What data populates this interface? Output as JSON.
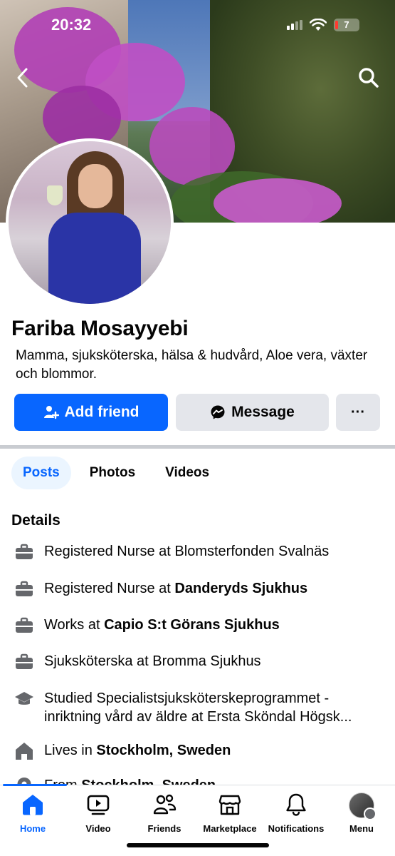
{
  "status_bar": {
    "time": "20:32",
    "battery_level": "7"
  },
  "profile": {
    "name": "Fariba Mosayyebi",
    "bio": "Mamma, sjuksköterska, hälsa & hudvård, Aloe vera, växter och blommor."
  },
  "actions": {
    "add_friend_label": "Add friend",
    "message_label": "Message",
    "more_label": "···"
  },
  "tabs": [
    {
      "label": "Posts",
      "active": true
    },
    {
      "label": "Photos",
      "active": false
    },
    {
      "label": "Videos",
      "active": false
    }
  ],
  "details": {
    "title": "Details",
    "items": [
      {
        "icon": "briefcase-icon",
        "prefix": "Registered Nurse at Blomsterfonden Svalnäs",
        "bold": ""
      },
      {
        "icon": "briefcase-icon",
        "prefix": "Registered Nurse at ",
        "bold": "Danderyds Sjukhus"
      },
      {
        "icon": "briefcase-icon",
        "prefix": "Works at ",
        "bold": "Capio S:t Görans Sjukhus"
      },
      {
        "icon": "briefcase-icon",
        "prefix": "Sjuksköterska at Bromma Sjukhus",
        "bold": ""
      },
      {
        "icon": "graduation-cap-icon",
        "prefix": "Studied Specialistsjuksköterskeprogrammet - inriktning vård av äldre at Ersta Sköndal Högsk...",
        "bold": ""
      },
      {
        "icon": "home-icon",
        "prefix": "Lives in ",
        "bold": "Stockholm, Sweden"
      },
      {
        "icon": "location-pin-icon",
        "prefix": "From ",
        "bold": "Stockholm, Sweden"
      }
    ]
  },
  "bottom_nav": [
    {
      "label": "Home",
      "icon": "home-icon",
      "active": true
    },
    {
      "label": "Video",
      "icon": "video-icon",
      "active": false
    },
    {
      "label": "Friends",
      "icon": "friends-icon",
      "active": false
    },
    {
      "label": "Marketplace",
      "icon": "marketplace-icon",
      "active": false
    },
    {
      "label": "Notifications",
      "icon": "bell-icon",
      "active": false
    },
    {
      "label": "Menu",
      "icon": "profile-avatar",
      "active": false
    }
  ],
  "colors": {
    "accent": "#0866ff",
    "button_gray": "#e4e6eb",
    "tab_active_bg": "#ebf5ff"
  }
}
